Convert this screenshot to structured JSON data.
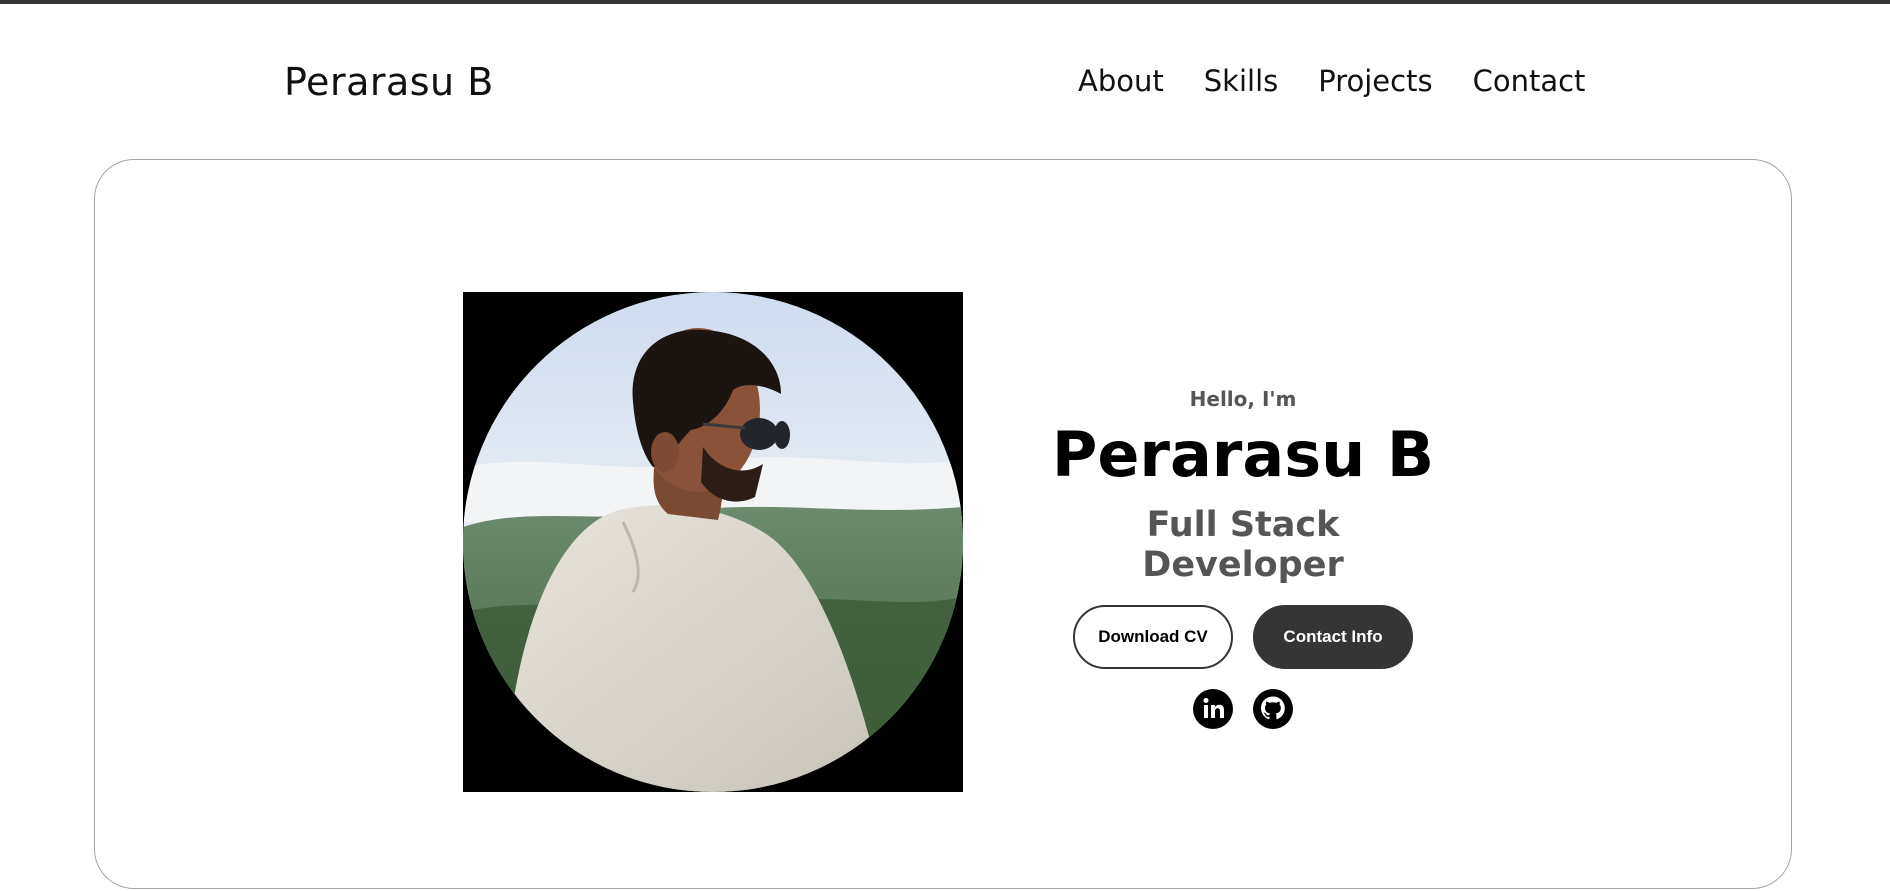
{
  "nav": {
    "logo": "Perarasu B",
    "links": [
      "About",
      "Skills",
      "Projects",
      "Contact"
    ]
  },
  "hero": {
    "greeting": "Hello, I'm",
    "name": "Perarasu B",
    "role": "Full Stack Developer",
    "buttons": {
      "download_cv": "Download CV",
      "contact_info": "Contact Info"
    },
    "socials": [
      "linkedin-icon",
      "github-icon"
    ]
  },
  "colors": {
    "dark": "#353535",
    "muted_text": "#555555",
    "border": "#a3a3a3"
  }
}
